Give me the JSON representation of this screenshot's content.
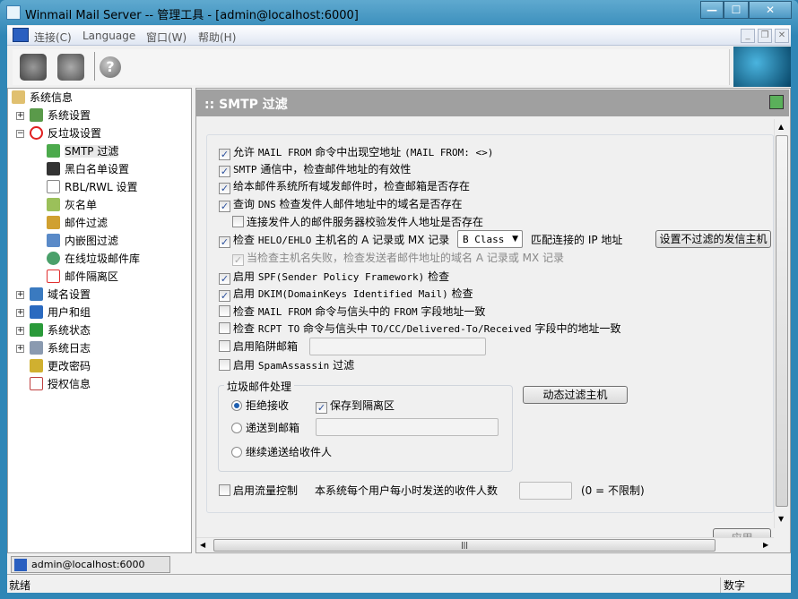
{
  "window": {
    "title": "Winmail Mail Server -- 管理工具 - [admin@localhost:6000]",
    "minimize": "—",
    "maximize": "☐",
    "close": "✕"
  },
  "menu": {
    "items": [
      "连接(C)",
      "Language",
      "窗口(W)",
      "帮助(H)"
    ]
  },
  "toolbar": {
    "icons": [
      "connect-icon",
      "disconnect-icon",
      "help-icon"
    ],
    "help_glyph": "?"
  },
  "tree": {
    "items": [
      {
        "label": "系统信息",
        "icon": "info-book-icon"
      },
      {
        "label": "系统设置",
        "icon": "settings-icon",
        "expander": "+"
      },
      {
        "label": "反垃圾设置",
        "icon": "antispam-icon",
        "expander": "−"
      },
      {
        "label": "SMTP 过滤",
        "icon": "smtp-filter-icon"
      },
      {
        "label": "黑白名单设置",
        "icon": "blackwhite-list-icon"
      },
      {
        "label": "RBL/RWL 设置",
        "icon": "rbl-icon"
      },
      {
        "label": "灰名单",
        "icon": "greylist-icon"
      },
      {
        "label": "邮件过滤",
        "icon": "mail-filter-icon"
      },
      {
        "label": "内嵌图过滤",
        "icon": "image-filter-icon"
      },
      {
        "label": "在线垃圾邮件库",
        "icon": "online-spam-db-icon"
      },
      {
        "label": "邮件隔离区",
        "icon": "quarantine-icon"
      },
      {
        "label": "域名设置",
        "icon": "domain-icon",
        "expander": "+"
      },
      {
        "label": "用户和组",
        "icon": "users-icon",
        "expander": "+"
      },
      {
        "label": "系统状态",
        "icon": "status-icon",
        "expander": "+"
      },
      {
        "label": "系统日志",
        "icon": "log-icon",
        "expander": "+"
      },
      {
        "label": "更改密码",
        "icon": "key-icon"
      },
      {
        "label": "授权信息",
        "icon": "license-icon"
      }
    ]
  },
  "panel": {
    "title": ":: SMTP 过滤"
  },
  "options": [
    {
      "cn1": "允许 ",
      "mono": "MAIL FROM",
      "cn2": " 命令中出现空地址 ",
      "mono2": "(MAIL FROM: <>)",
      "checked": true
    },
    {
      "cn1": "",
      "mono": "SMTP",
      "cn2": " 通信中，检查邮件地址的有效性",
      "mono2": "",
      "checked": true
    },
    {
      "cn1": "给本邮件系统所有域发邮件时，检查邮箱是否存在",
      "mono": "",
      "cn2": "",
      "mono2": "",
      "checked": true
    },
    {
      "cn1": "查询 ",
      "mono": "DNS",
      "cn2": " 检查发件人邮件地址中的域名是否存在",
      "mono2": "",
      "checked": true
    },
    {
      "cn1": "连接发件人的邮件服务器校验发件人地址是否存在",
      "mono": "",
      "cn2": "",
      "mono2": "",
      "checked": false
    },
    {
      "cn1": "检查 ",
      "mono": "HELO/EHLO",
      "cn2": " 主机名的 A 记录或 MX 记录",
      "mono2": "",
      "checked": true
    },
    {
      "cn1": "当检查主机名失败，检查发送者邮件地址的域名 A 记录或 MX 记录",
      "mono": "",
      "cn2": "",
      "mono2": "",
      "checked": true,
      "disabled": true
    },
    {
      "cn1": "启用 ",
      "mono": "SPF(Sender Policy Framework)",
      "cn2": " 检查",
      "mono2": "",
      "checked": true
    },
    {
      "cn1": "启用 ",
      "mono": "DKIM(DomainKeys Identified Mail)",
      "cn2": " 检查",
      "mono2": "",
      "checked": true
    },
    {
      "cn1": "检查 ",
      "mono": "MAIL FROM",
      "cn2": " 命令与信头中的 ",
      "mono2": "FROM",
      "cn3": " 字段地址一致",
      "checked": false
    },
    {
      "cn1": "检查 ",
      "mono": "RCPT TO",
      "cn2": " 命令与信头中 ",
      "mono2": "TO/CC/Delivered-To/Received",
      "cn3": " 字段中的地址一致",
      "checked": false
    },
    {
      "cn1": "启用陷阱邮箱",
      "mono": "",
      "cn2": "",
      "mono2": "",
      "checked": false
    },
    {
      "cn1": "启用 ",
      "mono": "SpamAssassin",
      "cn2": " 过滤",
      "mono2": "",
      "checked": false
    }
  ],
  "helo": {
    "select_value": "B Class",
    "select_arrow": "▼",
    "match_label": "匹配连接的 IP 地址",
    "exclude_button": "设置不过滤的发信主机"
  },
  "trap_input": {
    "value": ""
  },
  "spam_handling": {
    "legend": "垃圾邮件处理",
    "reject": "拒绝接收",
    "save_quarantine": "保存到隔离区",
    "deliver_mailbox": "递送到邮箱",
    "deliver_mailbox_value": "",
    "continue": "继续递送给收件人",
    "selected": "reject",
    "save_quarantine_checked": true
  },
  "dynamic_button": "动态过滤主机",
  "flow": {
    "label": "启用流量控制",
    "desc": "本系统每个用户每小时发送的收件人数",
    "value": "",
    "hint": "(0 = 不限制)",
    "checked": false
  },
  "apply_button": "应用",
  "tabs": [
    {
      "label": "admin@localhost:6000"
    }
  ],
  "status": {
    "left": "就绪",
    "numlock": "数字"
  }
}
